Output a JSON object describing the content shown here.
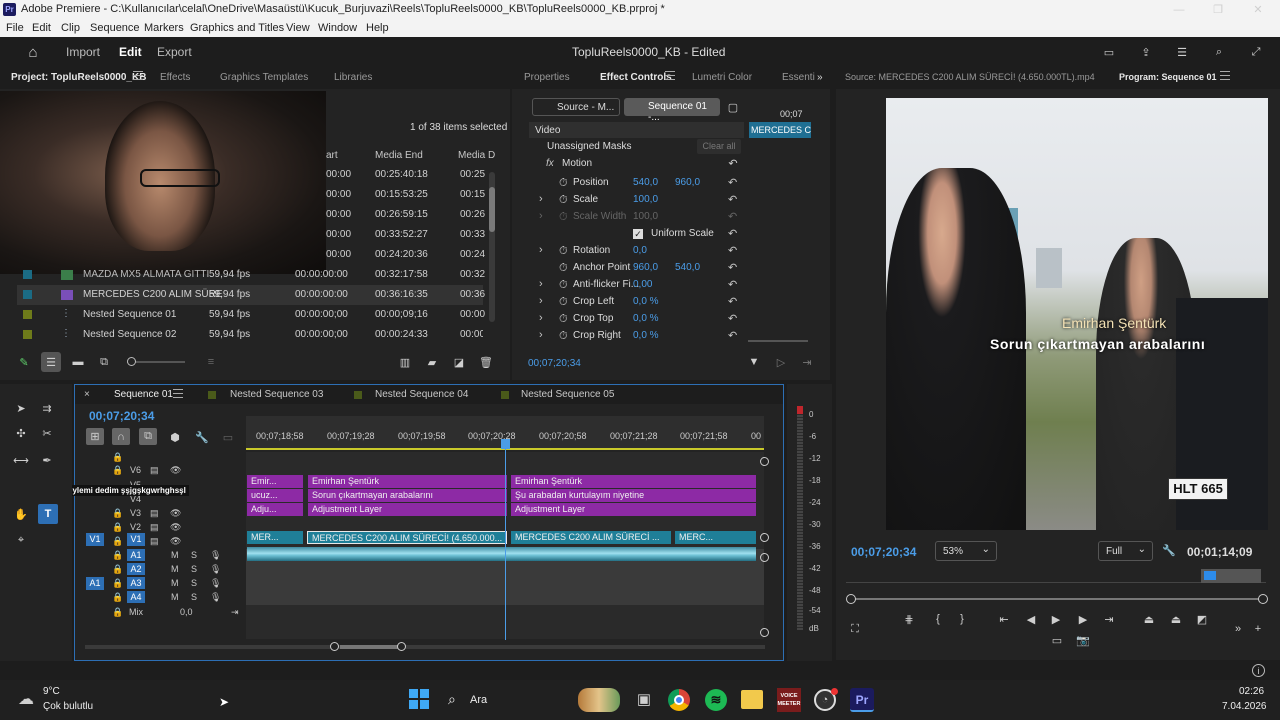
{
  "titlebar": {
    "app_icon": "Pr",
    "title": "Adobe Premiere - C:\\Kullanıcılar\\celal\\OneDrive\\Masaüstü\\Kucuk_Burjuvazi\\Reels\\TopluReels0000_KB\\TopluReels0000_KB.prproj *"
  },
  "menu": [
    "File",
    "Edit",
    "Clip",
    "Sequence",
    "Markers",
    "Graphics and Titles",
    "View",
    "Window",
    "Help"
  ],
  "workspace": {
    "tabs": [
      "Import",
      "Edit",
      "Export"
    ],
    "project_title": "TopluReels0000_KB - Edited"
  },
  "project_panel": {
    "tabs": [
      "Project: TopluReels0000_KB",
      "Effects",
      "Graphics Templates",
      "Libraries"
    ],
    "items_selected": "1 of 38 items selected",
    "columns": [
      "Media Start",
      "Media End",
      "Media D"
    ],
    "media_start_partial": "art",
    "rows": [
      {
        "name": "",
        "fps": "",
        "start": "00:00",
        "end": "00:25:40:18",
        "dur": "00:25"
      },
      {
        "name": "",
        "fps": "",
        "start": "00:00",
        "end": "00:15:53:25",
        "dur": "00:15"
      },
      {
        "name": "",
        "fps": "",
        "start": "00:00",
        "end": "00:26:59:15",
        "dur": "00:26"
      },
      {
        "name": "",
        "fps": "",
        "start": "00:00",
        "end": "00:33:52:27",
        "dur": "00:33"
      },
      {
        "name": "",
        "fps": "",
        "start": "00:00",
        "end": "00:24:20:36",
        "dur": "00:24"
      },
      {
        "name": "MAZDA MX5 ALMATA GITTI",
        "fps": "59,94 fps",
        "start": "00:00:00:00",
        "end": "00:32:17:58",
        "dur": "00:32"
      },
      {
        "name": "MERCEDES C200 ALIM SÜRE",
        "fps": "59,94 fps",
        "start": "00:00:00:00",
        "end": "00:36:16:35",
        "dur": "00:36"
      },
      {
        "name": "Nested Sequence 01",
        "fps": "59,94 fps",
        "start": "00:00:00;00",
        "end": "00:00;09;16",
        "dur": "00:00"
      },
      {
        "name": "Nested Sequence 02",
        "fps": "59,94 fps",
        "start": "00:00:00;00",
        "end": "00:00:24:33",
        "dur": "00:00"
      }
    ]
  },
  "effect_controls": {
    "tabs": [
      "Properties",
      "Effect Controls",
      "Lumetri Color",
      "Essenti"
    ],
    "source_btn": "Source - M...",
    "sequence_btn": "Sequence 01 -...",
    "mini_time": "00;07",
    "mini_clip": "MERCEDES C2",
    "section": "Video",
    "unassigned": "Unassigned Masks",
    "clear_all": "Clear all",
    "motion": "Motion",
    "props": [
      {
        "label": "Position",
        "v1": "540,0",
        "v2": "960,0"
      },
      {
        "label": "Scale",
        "v1": "100,0",
        "v2": ""
      },
      {
        "label": "Scale Width",
        "v1": "100,0",
        "v2": ""
      },
      {
        "label": "Uniform Scale",
        "v1": "",
        "v2": ""
      },
      {
        "label": "Rotation",
        "v1": "0,0",
        "v2": ""
      },
      {
        "label": "Anchor Point",
        "v1": "960,0",
        "v2": "540,0"
      },
      {
        "label": "Anti-flicker Fi...",
        "v1": "0,00",
        "v2": ""
      },
      {
        "label": "Crop Left",
        "v1": "0,0 %",
        "v2": ""
      },
      {
        "label": "Crop Top",
        "v1": "0,0 %",
        "v2": ""
      },
      {
        "label": "Crop Right",
        "v1": "0,0 %",
        "v2": ""
      }
    ],
    "timecode": "00;07;20;34"
  },
  "monitor": {
    "source_tab": "Source: MERCEDES C200 ALIM SÜRECİ! (4.650.000TL).mp4",
    "program_tab": "Program: Sequence 01",
    "caption_name": "Emirhan Şentürk",
    "caption_line": "Sorun çıkartmayan arabalarını",
    "plate": "HLT 665",
    "timecode": "00;07;20;34",
    "zoom": "53%",
    "quality": "Full",
    "duration": "00;01;14;09"
  },
  "timeline": {
    "tabs": [
      "Sequence 01",
      "Nested Sequence 03",
      "Nested Sequence 04",
      "Nested Sequence 05"
    ],
    "timecode": "00;07;20;34",
    "ruler": [
      "00;07;18;58",
      "00;07;19;28",
      "00;07;19;58",
      "00;07;20;28",
      "00;07;20;58",
      "00;07;21;28",
      "00;07;21;58",
      "00"
    ],
    "video_tracks": [
      "V6",
      "V5",
      "V4",
      "V3",
      "V2",
      "V1"
    ],
    "audio_tracks": [
      "A1",
      "A2",
      "A3",
      "A4"
    ],
    "mix_label": "Mix",
    "mix_value": "0,0",
    "src_v": "V1",
    "src_a": "A1",
    "clips_v5": [
      "Emir...",
      "Emirhan Şentürk",
      "Emirhan Şentürk"
    ],
    "clips_v4": [
      "ucuz...",
      "Sorun çıkartmayan arabalarını",
      "Şu arabadan kurtulayım niyetine"
    ],
    "clips_v3": [
      "Adju...",
      "Adjustment Layer",
      "Adjustment Layer"
    ],
    "clips_v1": [
      "MER...",
      "MERCEDES C200 ALIM SÜRECİ! (4.650.000...",
      "MERCEDES C200 ALIM SÜRECİ ...",
      "MERC..."
    ],
    "overlay_caption": "tubographer: an öylemi dedim şşjgşkgwrhghsşl"
  },
  "meter_scale": [
    "0",
    "-6",
    "-12",
    "-18",
    "-24",
    "-30",
    "-36",
    "-42",
    "-48",
    "-54",
    "dB"
  ],
  "taskbar": {
    "temp": "9°C",
    "weather": "Çok bulutlu",
    "search": "Ara",
    "time": "02:26",
    "date": "7.04.2026",
    "voicemeeter": "VOICE MEETER"
  },
  "colors": {
    "accent": "#2d8ceb",
    "purple_clip": "#8d2aa5",
    "teal_clip": "#1f7f98",
    "playhead": "#4b9de8"
  }
}
